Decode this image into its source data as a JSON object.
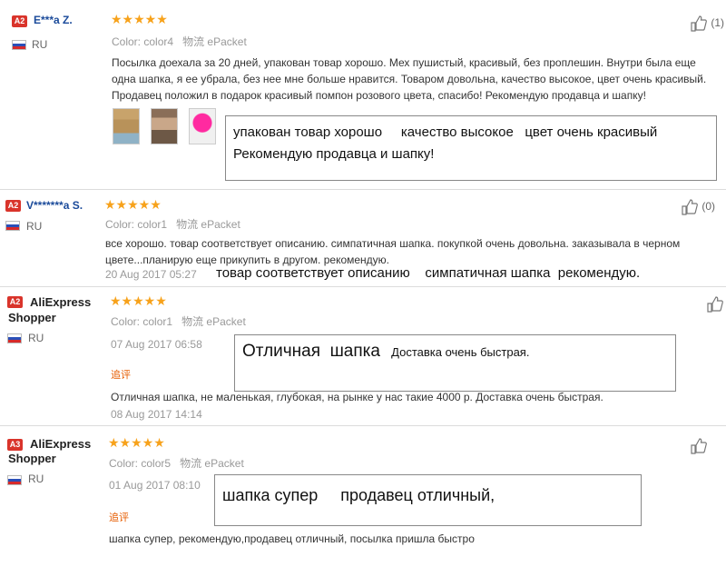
{
  "reviews": [
    {
      "badge": "A2",
      "name": "E***a Z.",
      "country": "RU",
      "stars": "★★★★★",
      "color_label": "Color:",
      "color_value": "color4",
      "ship_label": "物流",
      "ship_value": "ePacket",
      "text_lines": [
        "Посылка доехала за 20 дней, упакован товар хорошо. Мех пушистый, красивый, без проплешин. Внутри была еще",
        "одна шапка, я ее убрала, без нее мне больше нравится. Товаром довольна, качество высокое, цвет очень красивый.",
        "Продавец положил в подарок красивый помпон розового цвета, спасибо! Рекомендую продавца и шапку!"
      ],
      "like_count": "(1)",
      "callout_lines": [
        "упакован товар хорошо     качество высокое   цвет очень красивый",
        "Рекомендую продавца и шапку!"
      ]
    },
    {
      "badge": "A2",
      "name": "V*******a S.",
      "country": "RU",
      "stars": "★★★★★",
      "color_label": "Color:",
      "color_value": "color1",
      "ship_label": "物流",
      "ship_value": "ePacket",
      "text_lines": [
        "все хорошо. товар соответствует описанию. симпатичная шапка. покупкой очень довольна. заказывала в черном",
        "цвете...планирую еще прикупить в другом. рекомендую."
      ],
      "date": "20 Aug 2017 05:27",
      "like_count": "(0)",
      "callout": "товар соответствует описанию    симпатичная шапка  рекомендую."
    },
    {
      "badge": "A2",
      "name_line1": "AliExpress",
      "name_line2": "Shopper",
      "country": "RU",
      "stars": "★★★★★",
      "color_label": "Color:",
      "color_value": "color1",
      "ship_label": "物流",
      "ship_value": "ePacket",
      "date": "07 Aug 2017 06:58",
      "followup": "追评",
      "followup_text": "Отличная шапка, не маленькая, глубокая, на рынке у нас такие 4000 р. Доставка очень быстрая.",
      "followup_date": "08 Aug 2017 14:14",
      "callout_big": "Отличная  шапка",
      "callout_small": "Доставка очень быстрая."
    },
    {
      "badge": "A3",
      "name_line1": "AliExpress",
      "name_line2": "Shopper",
      "country": "RU",
      "stars": "★★★★★",
      "color_label": "Color:",
      "color_value": "color5",
      "ship_label": "物流",
      "ship_value": "ePacket",
      "date": "01 Aug 2017 08:10",
      "followup": "追评",
      "followup_text": "шапка супер, рекомендую,продавец отличный, посылка пришла быстро",
      "callout": "шапка супер     продавец отличный,"
    }
  ],
  "colors": {
    "star": "#f7a21b",
    "badge": "#d9342b",
    "name": "#1a4a9a",
    "followup": "#e65c00"
  }
}
